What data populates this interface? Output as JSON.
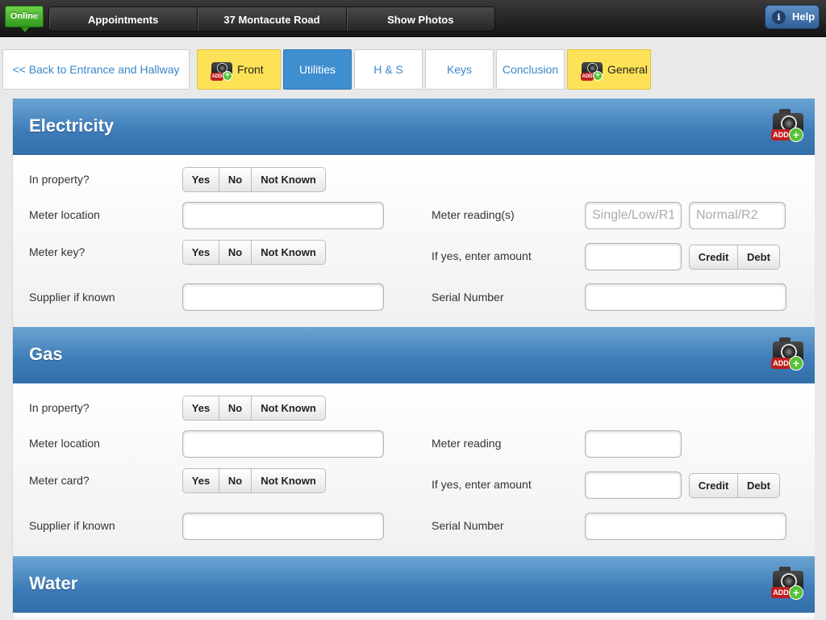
{
  "topbar": {
    "status": "Online",
    "nav": [
      "Appointments",
      "37 Montacute Road",
      "Show Photos"
    ],
    "help": "Help"
  },
  "tabs": {
    "back": "<< Back to Entrance and Hallway",
    "front": "Front",
    "utilities": "Utilities",
    "hs": "H & S",
    "keys": "Keys",
    "conclusion": "Conclusion",
    "general": "General"
  },
  "camera": {
    "add": "ADD",
    "plus": "+"
  },
  "choices": {
    "yes": "Yes",
    "no": "No",
    "not_known": "Not Known",
    "credit": "Credit",
    "debt": "Debt"
  },
  "electricity": {
    "title": "Electricity",
    "in_property": "In property?",
    "meter_location": "Meter location",
    "meter_readings": "Meter reading(s)",
    "reading1_placeholder": "Single/Low/R1",
    "reading2_placeholder": "Normal/R2",
    "meter_key": "Meter key?",
    "if_yes_amount": "If yes, enter amount",
    "supplier": "Supplier if known",
    "serial": "Serial Number"
  },
  "gas": {
    "title": "Gas",
    "in_property": "In property?",
    "meter_location": "Meter location",
    "meter_reading": "Meter reading",
    "meter_card": "Meter card?",
    "if_yes_amount": "If yes, enter amount",
    "supplier": "Supplier if known",
    "serial": "Serial Number"
  },
  "water": {
    "title": "Water"
  }
}
